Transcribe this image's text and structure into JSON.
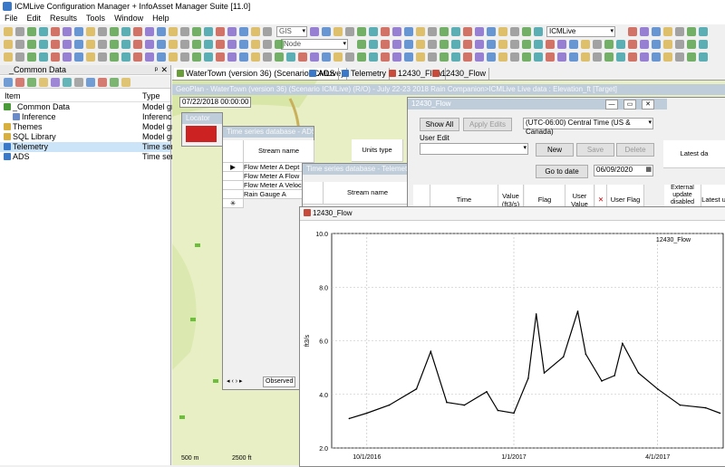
{
  "window_title": "ICMLive Configuration Manager + InfoAsset Manager Suite [11.0]",
  "menu": [
    "File",
    "Edit",
    "Results",
    "Tools",
    "Window",
    "Help"
  ],
  "toolbar": {
    "gis_combo": "GIS",
    "node_combo": "Node",
    "icmlive_combo": "ICMLive"
  },
  "left_panel": {
    "title": "_Common Data",
    "col_item": "Item",
    "col_type": "Type",
    "rows": [
      {
        "name": "_Common Data",
        "type": "Model gr",
        "icon": "folder-green-icon"
      },
      {
        "name": "Inference",
        "type": "Inference",
        "icon": "inference-icon"
      },
      {
        "name": "Themes",
        "type": "Model gr",
        "icon": "folder-icon"
      },
      {
        "name": "SQL Library",
        "type": "Model gr",
        "icon": "folder-icon"
      },
      {
        "name": "Telemetry",
        "type": "Time seri",
        "icon": "telemetry-icon"
      },
      {
        "name": "ADS",
        "type": "Time seri",
        "icon": "telemetry-icon"
      }
    ]
  },
  "tabs": [
    "WaterTown (version 36) (Scenario ICMLive)",
    "ADS",
    "Telemetry",
    "12430_Flow",
    "12430_Flow"
  ],
  "geoplan": {
    "title": "GeoPlan - WaterTown (version 36) (Scenario ICMLive)  (R/O) - July 22-23 2018 Rain Companion>ICMLive Live data : Elevation_ft  [Target]",
    "timestamp": "07/22/2018 00:00:00",
    "scale_left": "500 m",
    "scale_right": "2500 ft"
  },
  "locator": {
    "title": "Locator"
  },
  "ts_ads": {
    "title": "Time series database - ADS",
    "col_stream": "Stream name",
    "col_units": "Units type",
    "rows": [
      "Flow Meter A Dept",
      "Flow Meter A Flow",
      "Flow Meter A Veloc",
      "Rain Gauge A"
    ],
    "footer_tab": "Observed"
  },
  "ts_telemetry": {
    "title": "Time series database - Telemetry",
    "col_stream": "Stream name"
  },
  "flow_editor": {
    "title": "12430_Flow",
    "show_all": "Show All",
    "apply_edits": "Apply Edits",
    "timezone": "(UTC-06:00) Central Time (US & Canada)",
    "user_edit_label": "User Edit",
    "new": "New",
    "save": "Save",
    "delete": "Delete",
    "go_to_date": "Go to date",
    "date_value": "06/09/2020",
    "cols": [
      "Time",
      "Value (ft3/s)",
      "Flag",
      "User Value",
      "User Flag",
      "External update disabled",
      "Latest u"
    ],
    "latest_header": "Latest da"
  },
  "chart_window": {
    "title": "12430_Flow"
  },
  "chart_data": {
    "type": "line",
    "title": "12430_Flow",
    "ylabel": "ft3/s",
    "ylim": [
      2.0,
      10.0
    ],
    "yticks": [
      "10.0",
      "8.0",
      "6.0",
      "4.0",
      "2.0"
    ],
    "xticks": [
      "10/1/2016",
      "1/1/2017",
      "4/1/2017"
    ],
    "grid": true,
    "color": "#000000",
    "series": [
      {
        "x": [
          "2016-09-20",
          "2016-10-01",
          "2016-10-15",
          "2016-11-01",
          "2016-11-10",
          "2016-11-20",
          "2016-12-01",
          "2016-12-15",
          "2016-12-22",
          "2017-01-01",
          "2017-01-10",
          "2017-01-15",
          "2017-01-20",
          "2017-02-01",
          "2017-02-10",
          "2017-02-15",
          "2017-02-25",
          "2017-03-05",
          "2017-03-10",
          "2017-03-20",
          "2017-04-01",
          "2017-04-15",
          "2017-05-01",
          "2017-05-10"
        ],
        "y": [
          3.1,
          3.3,
          3.6,
          4.2,
          5.6,
          3.7,
          3.6,
          4.1,
          3.4,
          3.3,
          4.6,
          7.0,
          4.8,
          5.4,
          7.1,
          5.5,
          4.5,
          4.7,
          5.9,
          4.8,
          4.2,
          3.6,
          3.5,
          3.3
        ]
      }
    ]
  }
}
